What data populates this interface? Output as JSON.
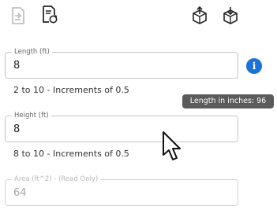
{
  "toolbar": {
    "icons": [
      {
        "name": "document-export-icon",
        "state": "disabled"
      },
      {
        "name": "document-refresh-icon",
        "state": "enabled"
      },
      {
        "name": "cube-export-icon",
        "state": "enabled"
      },
      {
        "name": "cube-import-icon",
        "state": "enabled"
      }
    ]
  },
  "fields": {
    "length": {
      "label": "Length (ft)",
      "value": "8",
      "helper": "2 to 10 - Increments of 0.5"
    },
    "height": {
      "label": "Height (ft)",
      "value": "8",
      "helper": "8 to 10 - Increments of 0.5"
    },
    "area": {
      "label": "Area (ft^2) - (Read Only)",
      "value": "64"
    }
  },
  "info": {
    "icon": "info-icon",
    "glyph": "i",
    "color": "#1a73d6"
  },
  "tooltip": {
    "text": "Length in inches: 96"
  }
}
